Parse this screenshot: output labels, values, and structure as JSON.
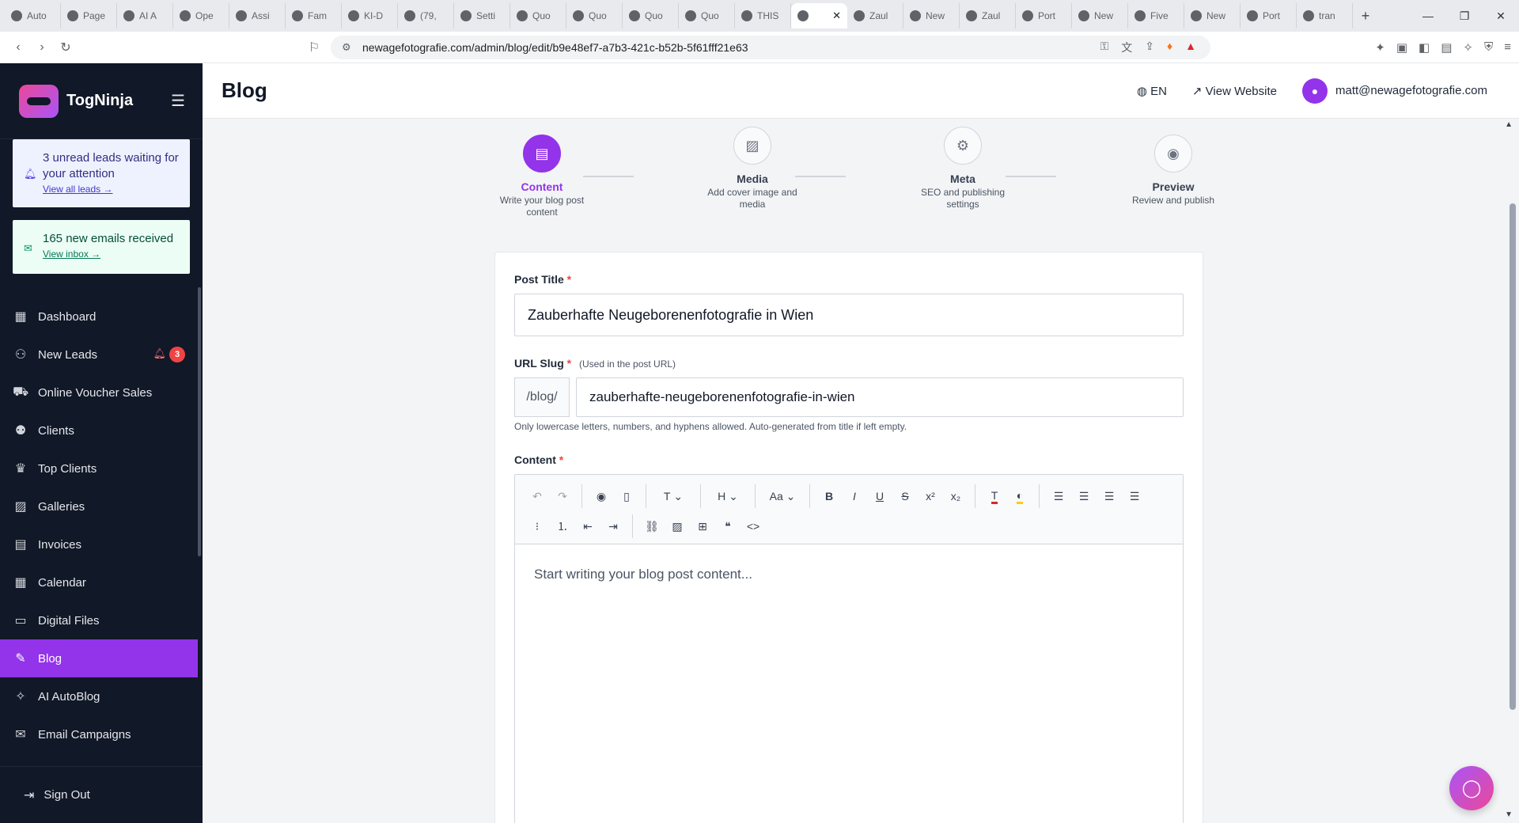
{
  "browser": {
    "tabs": [
      {
        "label": "Auto"
      },
      {
        "label": "Page"
      },
      {
        "label": "AI A"
      },
      {
        "label": "Ope"
      },
      {
        "label": "Assi"
      },
      {
        "label": "Fam"
      },
      {
        "label": "KI-D"
      },
      {
        "label": "(79,"
      },
      {
        "label": "Setti"
      },
      {
        "label": "Quo"
      },
      {
        "label": "Quo"
      },
      {
        "label": "Quo"
      },
      {
        "label": "Quo"
      },
      {
        "label": "THIS"
      },
      {
        "label": ""
      },
      {
        "label": "Zaul"
      },
      {
        "label": "New"
      },
      {
        "label": "Zaul"
      },
      {
        "label": "Port"
      },
      {
        "label": "New"
      },
      {
        "label": "Five"
      },
      {
        "label": "New"
      },
      {
        "label": "Port"
      },
      {
        "label": "tran"
      }
    ],
    "active_tab_index": 14,
    "url": "newagefotografie.com/admin/blog/edit/b9e48ef7-a7b3-421c-b52b-5f61fff21e63"
  },
  "sidebar": {
    "brand": "TogNinja",
    "leads_notice": {
      "text": "3 unread leads waiting for your attention",
      "link": "View all leads →"
    },
    "mail_notice": {
      "text": "165 new emails received",
      "link": "View inbox →"
    },
    "items": [
      {
        "label": "Dashboard",
        "icon": "dashboard-icon"
      },
      {
        "label": "New Leads",
        "icon": "user-plus-icon",
        "badge": "3"
      },
      {
        "label": "Online Voucher Sales",
        "icon": "cart-icon"
      },
      {
        "label": "Clients",
        "icon": "users-icon"
      },
      {
        "label": "Top Clients",
        "icon": "crown-icon"
      },
      {
        "label": "Galleries",
        "icon": "image-icon"
      },
      {
        "label": "Invoices",
        "icon": "file-icon"
      },
      {
        "label": "Calendar",
        "icon": "calendar-icon"
      },
      {
        "label": "Digital Files",
        "icon": "folder-icon"
      },
      {
        "label": "Blog",
        "icon": "pen-icon",
        "active": true
      },
      {
        "label": "AI AutoBlog",
        "icon": "wand-icon"
      },
      {
        "label": "Email Campaigns",
        "icon": "mail-icon"
      }
    ],
    "sign_out": "Sign Out"
  },
  "header": {
    "title": "Blog",
    "language": "EN",
    "view_website": "View Website",
    "user_email": "matt@newagefotografie.com"
  },
  "steps": [
    {
      "title": "Content",
      "desc": "Write your blog post content",
      "active": true
    },
    {
      "title": "Media",
      "desc": "Add cover image and media"
    },
    {
      "title": "Meta",
      "desc": "SEO and publishing settings"
    },
    {
      "title": "Preview",
      "desc": "Review and publish"
    }
  ],
  "form": {
    "title_label": "Post Title",
    "title_value": "Zauberhafte Neugeborenenfotografie in Wien",
    "slug_label": "URL Slug",
    "slug_hint": "(Used in the post URL)",
    "slug_prefix": "/blog/",
    "slug_value": "zauberhafte-neugeborenenfotografie-in-wien",
    "slug_helper": "Only lowercase letters, numbers, and hyphens allowed. Auto-generated from title if left empty.",
    "content_label": "Content",
    "required_mark": "*",
    "content_placeholder": "Start writing your blog post content...",
    "toolbar": {
      "text_type": "T",
      "heading": "H",
      "font_size": "Aa"
    }
  },
  "colors": {
    "accent": "#9333ea",
    "sidebar_bg": "#111827",
    "badge": "#ef4444"
  }
}
